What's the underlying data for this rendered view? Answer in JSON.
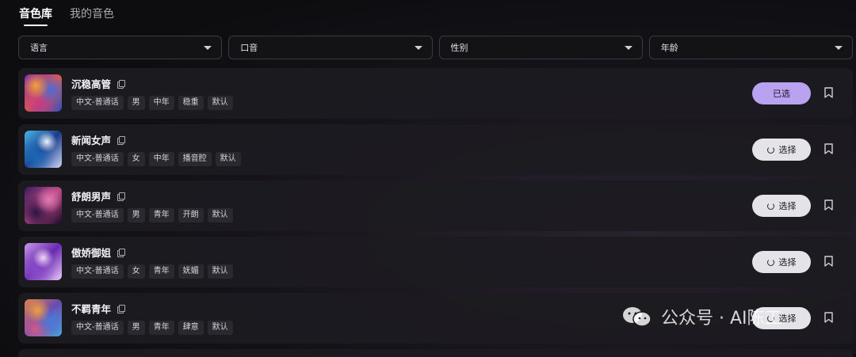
{
  "tabs": [
    {
      "label": "音色库",
      "active": true
    },
    {
      "label": "我的音色",
      "active": false
    }
  ],
  "filters": [
    {
      "label": "语言"
    },
    {
      "label": "口音"
    },
    {
      "label": "性别"
    },
    {
      "label": "年龄"
    }
  ],
  "voices": [
    {
      "name": "沉稳高管",
      "tags": [
        "中文-普通话",
        "男",
        "中年",
        "稳重",
        "默认"
      ],
      "button": "已选",
      "selected": true
    },
    {
      "name": "新闻女声",
      "tags": [
        "中文-普通话",
        "女",
        "中年",
        "播音腔",
        "默认"
      ],
      "button": "选择",
      "selected": false
    },
    {
      "name": "舒朗男声",
      "tags": [
        "中文-普通话",
        "男",
        "青年",
        "开朗",
        "默认"
      ],
      "button": "选择",
      "selected": false
    },
    {
      "name": "傲娇御姐",
      "tags": [
        "中文-普通话",
        "女",
        "青年",
        "妩媚",
        "默认"
      ],
      "button": "选择",
      "selected": false
    },
    {
      "name": "不羁青年",
      "tags": [
        "中文-普通话",
        "男",
        "青年",
        "肆意",
        "默认"
      ],
      "button": "选择",
      "selected": false
    }
  ],
  "watermark": {
    "text": "公众号 · AI陈工"
  },
  "colors": {
    "accent": "#b9a3f0",
    "button": "#e4e4e8",
    "row": "#1c1b21"
  }
}
